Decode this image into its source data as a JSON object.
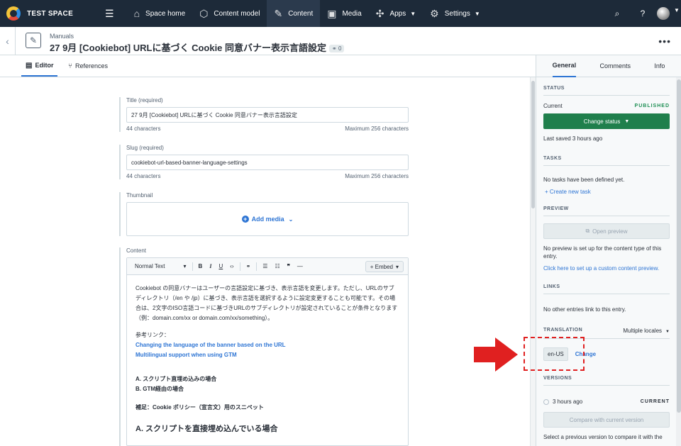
{
  "nav": {
    "space_name": "TEST SPACE",
    "items": [
      {
        "label": "Space home",
        "icon": "home-icon"
      },
      {
        "label": "Content model",
        "icon": "cube-icon"
      },
      {
        "label": "Content",
        "icon": "edit-icon"
      },
      {
        "label": "Media",
        "icon": "image-icon"
      },
      {
        "label": "Apps",
        "icon": "apps-icon"
      },
      {
        "label": "Settings",
        "icon": "gear-icon"
      }
    ],
    "active": "Content"
  },
  "entry": {
    "content_type": "Manuals",
    "title": "27 9月 [Cookiebot] URLに基づく Cookie 同意バナー表示言語設定",
    "link_count": "0"
  },
  "tabs": {
    "editor": "Editor",
    "references": "References"
  },
  "fields": {
    "title": {
      "label": "Title (required)",
      "value": "27 9月 [Cookiebot] URLに基づく Cookie 同意バナー表示言語設定",
      "count": "44 characters",
      "max": "Maximum 256 characters"
    },
    "slug": {
      "label": "Slug (required)",
      "value": "cookiebot-url-based-banner-language-settings",
      "count": "44 characters",
      "max": "Maximum 256 characters"
    },
    "thumbnail": {
      "label": "Thumbnail",
      "add_media": "Add media"
    },
    "content": {
      "label": "Content",
      "toolbar": {
        "format": "Normal Text",
        "embed": "+ Embed"
      },
      "paragraph1": "Cookiebot の同意バナーはユーザーの言語設定に基づき、表示言語を変更します。ただし、URLのサブディレクトリ（/en や /jp）に基づき、表示言語を選択するように設定変更することも可能です。その場合は、2文字のISO言語コードに基づきURLのサブディレクトリが設定されていることが条件となります（例：domain.com/xx or domain.com/xx/something）。",
      "ref_label": "参考リンク：",
      "link1": "Changing the language of the banner based on the URL",
      "link2": "Multilingual support when using GTM",
      "list_a": "A. スクリプト直埋め込みの場合",
      "list_b": "B. GTM経由の場合",
      "supplement": "補足：Cookie ポリシー（宣言文）用のスニペット",
      "heading": "A. スクリプトを直接埋め込んでいる場合"
    }
  },
  "sidebar": {
    "tabs": [
      "General",
      "Comments",
      "Info"
    ],
    "status": {
      "title": "STATUS",
      "current_label": "Current",
      "current_value": "PUBLISHED",
      "change_button": "Change status",
      "last_saved": "Last saved 3 hours ago"
    },
    "tasks": {
      "title": "TASKS",
      "empty": "No tasks have been defined yet.",
      "create": "+ Create new task"
    },
    "preview": {
      "title": "PREVIEW",
      "open": "Open preview",
      "note": "No preview is set up for the content type of this entry.",
      "setup_link": "Click here to set up a custom content preview."
    },
    "links": {
      "title": "LINKS",
      "note": "No other entries link to this entry."
    },
    "translation": {
      "title": "TRANSLATION",
      "mode": "Multiple locales",
      "locale": "en-US",
      "change": "Change"
    },
    "versions": {
      "title": "VERSIONS",
      "time": "3 hours ago",
      "current": "CURRENT",
      "compare": "Compare with current version",
      "note": "Select a previous version to compare it with the"
    }
  },
  "colors": {
    "nav_bg": "#1d2a39",
    "accent": "#2e75d4",
    "published": "#1f7f4c",
    "annotation": "#e02020"
  }
}
